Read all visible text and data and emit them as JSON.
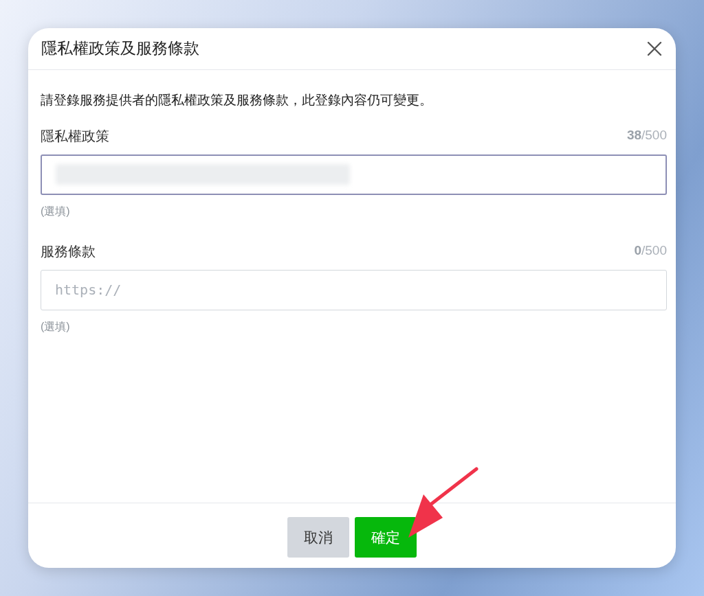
{
  "dialog": {
    "title": "隱私權政策及服務條款",
    "description": "請登錄服務提供者的隱私權政策及服務條款，此登錄內容仍可變更。",
    "fields": [
      {
        "label": "隱私權政策",
        "counter": "**38**/500",
        "value_redacted": true,
        "focused": true,
        "hint": "(選填)"
      },
      {
        "label": "服務條款",
        "counter": "**0**/500",
        "placeholder": "https://",
        "focused": false,
        "hint": "(選填)"
      }
    ],
    "buttons": [
      {
        "label": "取消",
        "kind": "secondary"
      },
      {
        "label": "確定",
        "kind": "primary"
      }
    ]
  },
  "annotation": {
    "kind": "arrow"
  }
}
